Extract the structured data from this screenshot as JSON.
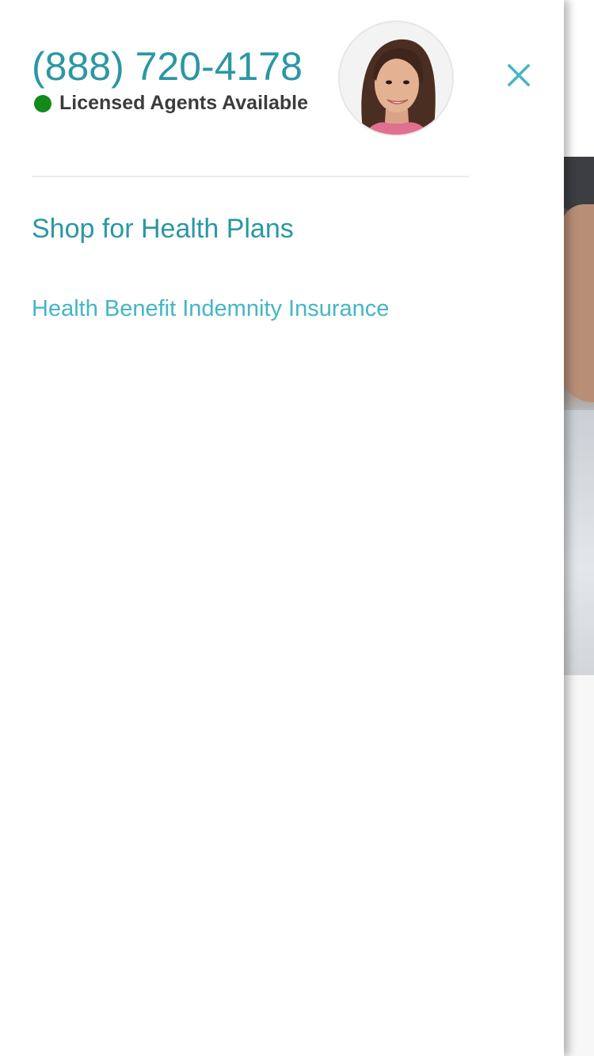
{
  "header": {
    "phone": "(888) 720-4178",
    "agents_status": "Licensed Agents Available"
  },
  "nav": {
    "primary_link": "Shop for Health Plans",
    "secondary_link": "Health Benefit Indemnity Insurance"
  },
  "icons": {
    "close": "close-icon",
    "status": "status-dot",
    "avatar": "agent-avatar"
  },
  "colors": {
    "brand_teal": "#2b97a3",
    "link_teal_light": "#44b6c4",
    "status_green": "#118a1a",
    "text_dark": "#3c3c3c"
  }
}
